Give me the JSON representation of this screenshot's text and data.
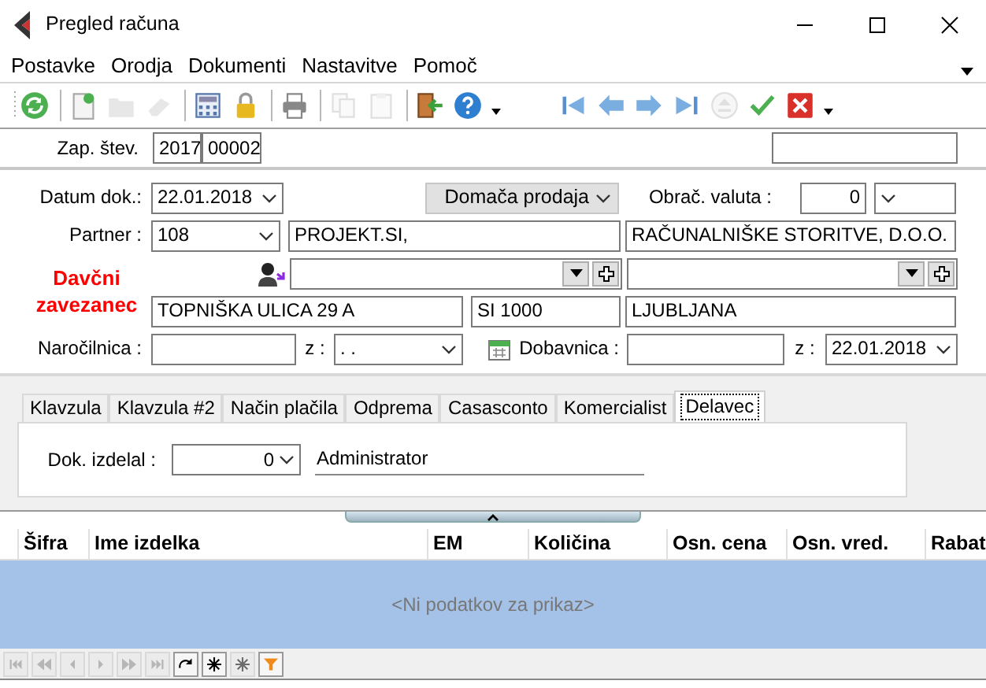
{
  "window": {
    "title": "Pregled računa"
  },
  "menu": [
    {
      "label": "Postavke"
    },
    {
      "label": "Orodja"
    },
    {
      "label": "Dokumenti"
    },
    {
      "label": "Nastavitve"
    },
    {
      "label": "Pomoč"
    }
  ],
  "toolbar": [
    {
      "kind": "refresh",
      "disabled": false
    },
    {
      "kind": "separator"
    },
    {
      "kind": "new",
      "disabled": false
    },
    {
      "kind": "folder",
      "disabled": true
    },
    {
      "kind": "eraser",
      "disabled": true
    },
    {
      "kind": "separator"
    },
    {
      "kind": "calculator",
      "disabled": false
    },
    {
      "kind": "lock",
      "disabled": false
    },
    {
      "kind": "separator"
    },
    {
      "kind": "printer",
      "disabled": false
    },
    {
      "kind": "separator"
    },
    {
      "kind": "copy",
      "disabled": true
    },
    {
      "kind": "paste",
      "disabled": true
    },
    {
      "kind": "separator"
    },
    {
      "kind": "exit",
      "disabled": false
    },
    {
      "kind": "help",
      "disabled": false
    },
    {
      "kind": "dropdown"
    },
    {
      "kind": "gap"
    },
    {
      "kind": "first",
      "disabled": false
    },
    {
      "kind": "prev",
      "disabled": false
    },
    {
      "kind": "next",
      "disabled": false
    },
    {
      "kind": "last",
      "disabled": false
    },
    {
      "kind": "eject",
      "disabled": true
    },
    {
      "kind": "confirm",
      "disabled": false
    },
    {
      "kind": "cancel",
      "disabled": false
    },
    {
      "kind": "dropdown"
    }
  ],
  "doc_number": {
    "label": "Zap. štev.",
    "year": "2017",
    "number": "00002"
  },
  "form": {
    "date_label": "Datum dok.:",
    "date": "22.01.2018",
    "sale_type": "Domača prodaja",
    "currency_label": "Obrač. valuta :",
    "currency_value": "0",
    "partner_label": "Partner :",
    "partner_code": "108",
    "partner_name": "PROJEKT.SI,",
    "partner_name_2": "RAČUNALNIŠKE STORITVE, D.O.O.",
    "tax_label": "Davčni zavezanec",
    "street": "TOPNIŠKA ULICA 29 A",
    "postal_code": "SI 1000",
    "city": "LJUBLJANA",
    "order_label": "Naročilnica :",
    "order_from_label": "z :",
    "order_date": ". .",
    "delivery_label": "Dobavnica :",
    "delivery_from_label": "z :",
    "delivery_date": "22.01.2018"
  },
  "tabs": [
    {
      "label": "Klavzula",
      "selected": false
    },
    {
      "label": "Klavzula #2",
      "selected": false
    },
    {
      "label": "Način plačila",
      "selected": false
    },
    {
      "label": "Odprema",
      "selected": false
    },
    {
      "label": "Casasconto",
      "selected": false
    },
    {
      "label": "Komercialist",
      "selected": false
    },
    {
      "label": "Delavec",
      "selected": true
    }
  ],
  "tab_panel": {
    "label": "Dok. izdelal :",
    "value": "0",
    "name": "Administrator"
  },
  "table": {
    "columns": [
      "Šifra",
      "Ime izdelka",
      "EM",
      "Količina",
      "Osn. cena",
      "Osn. vred.",
      "Rabat"
    ],
    "empty_text": "<Ni podatkov za prikaz>"
  },
  "navigator": [
    {
      "kind": "first",
      "disabled": true
    },
    {
      "kind": "prev-page",
      "disabled": true
    },
    {
      "kind": "prev",
      "disabled": true
    },
    {
      "kind": "next",
      "disabled": true
    },
    {
      "kind": "next-page",
      "disabled": true
    },
    {
      "kind": "last",
      "disabled": true
    },
    {
      "kind": "redo",
      "disabled": false
    },
    {
      "kind": "asterisk",
      "disabled": false
    },
    {
      "kind": "asterisk",
      "disabled": true
    },
    {
      "kind": "filter",
      "disabled": false
    }
  ]
}
